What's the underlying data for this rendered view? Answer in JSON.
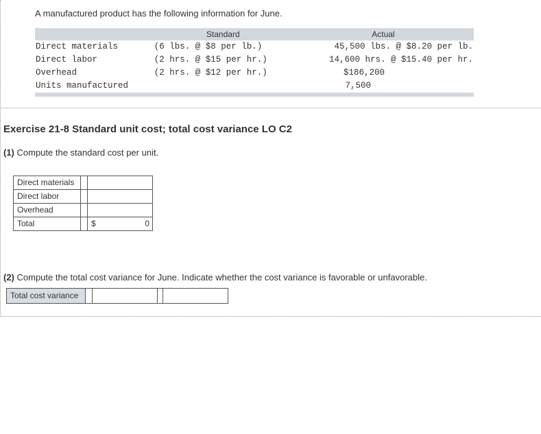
{
  "intro": "A manufactured product has the following information for June.",
  "info_table": {
    "headers": {
      "standard": "Standard",
      "actual": "Actual"
    },
    "rows": [
      {
        "label": "Direct materials",
        "standard": "(6 lbs. @ $8 per lb.)",
        "actual": "45,500 lbs. @ $8.20 per lb."
      },
      {
        "label": "Direct labor",
        "standard": "(2 hrs. @ $15 per hr.)",
        "actual": "14,600 hrs. @ $15.40 per hr."
      },
      {
        "label": "Overhead",
        "standard": "(2 hrs. @ $12 per hr.)",
        "actual": "$186,200"
      },
      {
        "label": "Units manufactured",
        "standard": "",
        "actual": "7,500"
      }
    ]
  },
  "exercise_title": "Exercise 21-8 Standard unit cost; total cost variance LO C2",
  "q1_num": "(1)",
  "q1_text": " Compute the standard cost per unit.",
  "calc_rows": {
    "r0": "Direct materials",
    "r1": "Direct labor",
    "r2": "Overhead",
    "r3": "Total"
  },
  "total_symbol": "$",
  "total_value": "0",
  "q2_num": "(2)",
  "q2_text": " Compute the total cost variance for June. Indicate whether the cost variance is favorable or unfavorable.",
  "variance_label": "Total cost variance"
}
